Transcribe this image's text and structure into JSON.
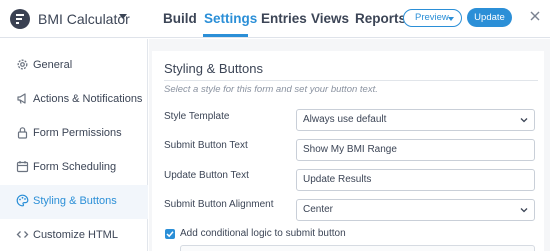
{
  "app": {
    "form_title": "BMI Calculator"
  },
  "nav": {
    "tabs": [
      {
        "label": "Build",
        "active": false
      },
      {
        "label": "Settings",
        "active": true
      },
      {
        "label": "Entries",
        "active": false
      },
      {
        "label": "Views",
        "active": false
      },
      {
        "label": "Reports",
        "active": false
      }
    ],
    "preview_label": "Preview",
    "update_label": "Update"
  },
  "sidebar": {
    "items": [
      {
        "label": "General",
        "icon": "gear-icon"
      },
      {
        "label": "Actions & Notifications",
        "icon": "megaphone-icon"
      },
      {
        "label": "Form Permissions",
        "icon": "lock-icon"
      },
      {
        "label": "Form Scheduling",
        "icon": "calendar-icon"
      },
      {
        "label": "Styling & Buttons",
        "icon": "palette-icon",
        "active": true
      },
      {
        "label": "Customize HTML",
        "icon": "code-icon"
      }
    ]
  },
  "main": {
    "section_title": "Styling & Buttons",
    "section_desc": "Select a style for this form and set your button text.",
    "fields": [
      {
        "label": "Style Template",
        "value": "Always use default",
        "type": "select"
      },
      {
        "label": "Submit Button Text",
        "value": "Show My BMI Range",
        "type": "text"
      },
      {
        "label": "Update Button Text",
        "value": "Update Results",
        "type": "text"
      },
      {
        "label": "Submit Button Alignment",
        "value": "Center",
        "type": "select"
      }
    ],
    "conditional_logic": {
      "label": "Add conditional logic to submit button",
      "checked": true
    }
  },
  "colors": {
    "accent": "#2b8fd7",
    "text": "#3c4556",
    "panel_bg": "#f5f6f8"
  }
}
